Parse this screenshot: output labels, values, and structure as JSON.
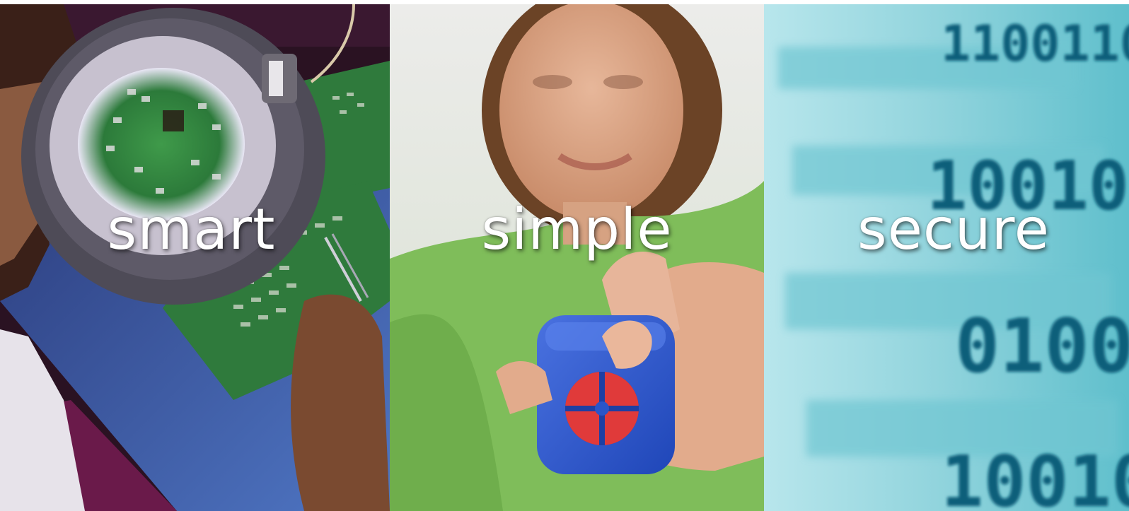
{
  "panels": [
    {
      "id": "smart",
      "label": "smart"
    },
    {
      "id": "simple",
      "label": "simple"
    },
    {
      "id": "secure",
      "label": "secure"
    }
  ],
  "colors": {
    "caption": "#ffffff",
    "smart_board": "#2f7a3c",
    "smart_desk": "#3d5fa8",
    "simple_background": "#7fbd5a",
    "simple_remote": "#2a55c8",
    "simple_remote_buttons": "#e03a3a",
    "secure_background": "#8fd3dc"
  },
  "icons": [
    "magnifier-lamp-photo",
    "remote-control-photo",
    "binary-code-photo"
  ]
}
